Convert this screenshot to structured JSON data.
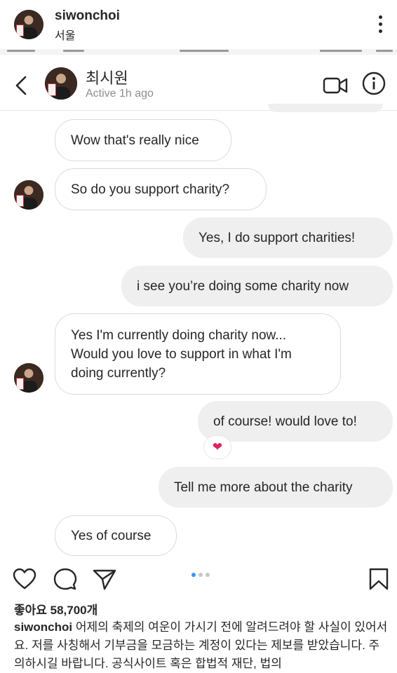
{
  "post": {
    "username": "siwonchoi",
    "location": "서울"
  },
  "dm": {
    "name": "최시원",
    "status": "Active 1h ago"
  },
  "messages": [
    {
      "side": "in",
      "text": "Wow that's really nice"
    },
    {
      "side": "in",
      "text": "So do you support charity?"
    },
    {
      "side": "out",
      "text": "Yes, I do support charities!"
    },
    {
      "side": "out",
      "text": "i see you’re doing some charity now"
    },
    {
      "side": "in",
      "text": "Yes I'm currently doing charity now...\nWould you love to support in what I'm\ndoing currently?"
    },
    {
      "side": "out",
      "text": "of course! would love to!"
    },
    {
      "side": "out",
      "text": "Tell me more about the charity"
    },
    {
      "side": "in",
      "text": "Yes of course"
    }
  ],
  "reaction": "❤",
  "likes": "좋아요 58,700개",
  "caption": {
    "username": "siwonchoi",
    "text": "어제의 축제의 여운이 가시기 전에 알려드려야 할 사실이 있어서요. 저를 사칭해서 기부금을 모금하는 계정이 있다는 제보를 받았습니다. 주의하시길 바랍니다. 공식사이트 혹은 합법적 재단, 법의"
  },
  "icons": {
    "more": "more-vertical-icon",
    "back": "chevron-left-icon",
    "video": "video-camera-icon",
    "info": "info-icon",
    "like": "heart-outline-icon",
    "comment": "comment-icon",
    "share": "paper-plane-icon",
    "save": "bookmark-icon"
  },
  "colors": {
    "out_bubble": "#efefef",
    "in_border": "#dbdbdb",
    "muted": "#8e8e8e",
    "carousel_active": "#3897f0",
    "heart": "#e0245e"
  }
}
